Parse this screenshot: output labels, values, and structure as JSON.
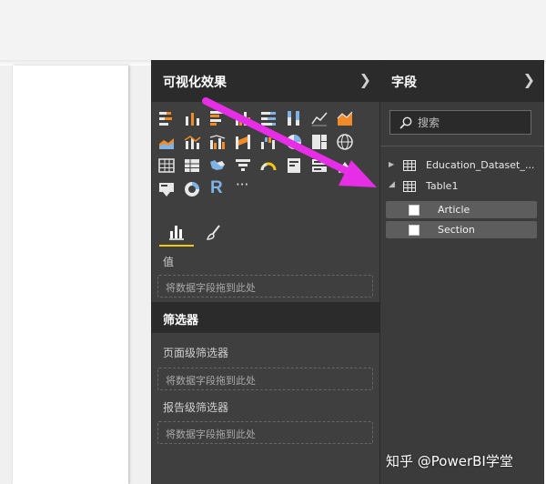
{
  "visualizations": {
    "title": "可视化效果",
    "icons": [
      "stacked-bar-icon",
      "stacked-column-icon",
      "clustered-bar-icon",
      "clustered-column-icon",
      "100pct-bar-icon",
      "100pct-column-icon",
      "line-chart-icon",
      "area-chart-icon",
      "stacked-area-icon",
      "line-column-icon",
      "line-clustered-column-icon",
      "ribbon-chart-icon",
      "waterfall-icon",
      "pie-chart-icon",
      "treemap-icon",
      "globe-map-icon",
      "table-icon",
      "matrix-icon",
      "filled-map-icon",
      "funnel-icon",
      "gauge-icon",
      "card-icon",
      "multi-row-card-icon",
      "kpi-icon",
      "slicer-icon",
      "donut-icon",
      "r-visual-icon",
      "more-icon"
    ],
    "r_letter": "R",
    "more_label": "···",
    "values_label": "值",
    "drop_hint": "将数据字段拖到此处",
    "filters_title": "筛选器",
    "page_filters_label": "页面级筛选器",
    "report_filters_label": "报告级筛选器"
  },
  "fields": {
    "title": "字段",
    "search_placeholder": "搜索",
    "tables": [
      {
        "name": "Education_Dataset_...",
        "expanded": false
      },
      {
        "name": "Table1",
        "expanded": true
      }
    ],
    "table1_fields": [
      "Article",
      "Section"
    ]
  },
  "watermark": "知乎 @PowerBI学堂",
  "colors": {
    "accent": "#f2c811",
    "arrow": "#e62ee6",
    "pane_dark": "#3f3f3f"
  }
}
